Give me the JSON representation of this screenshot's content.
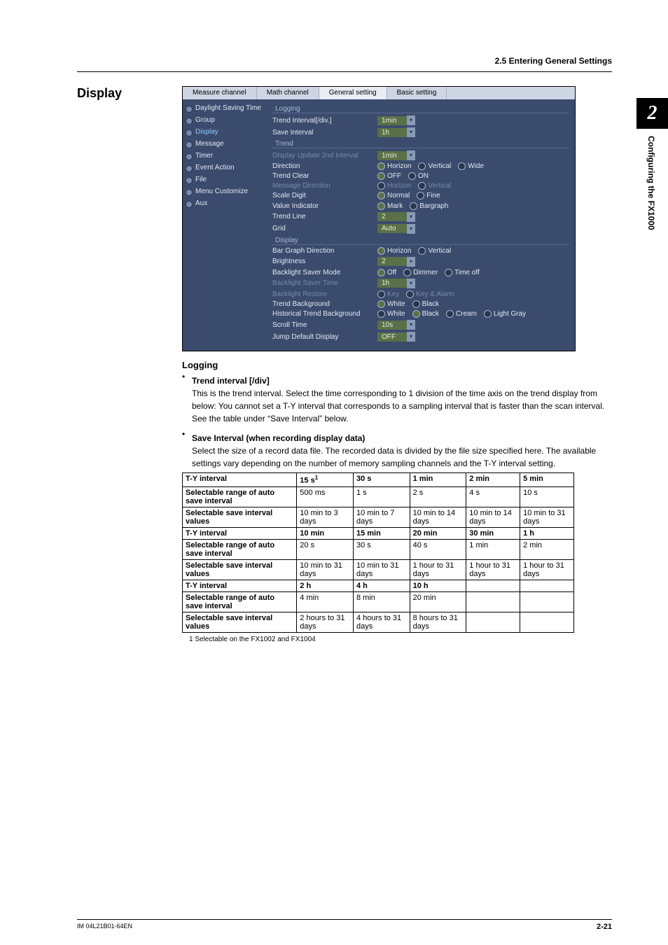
{
  "header": {
    "section": "2.5 Entering General Settings"
  },
  "sidetab": {
    "num": "2",
    "label": "Configuring the FX1000"
  },
  "heading": "Display",
  "screenshot": {
    "tabs": [
      "Measure channel",
      "Math channel",
      "General setting",
      "Basic setting"
    ],
    "active_tab": 2,
    "nav": [
      "Daylight Saving Time",
      "Group",
      "Display",
      "Message",
      "Timer",
      "Event Action",
      "File",
      "Menu Customize",
      "Aux"
    ],
    "nav_selected": "Display",
    "groups": {
      "logging": {
        "title": "Logging",
        "trend_interval_label": "Trend Interval[/div.]",
        "trend_interval_value": "1min",
        "save_interval_label": "Save Interval",
        "save_interval_value": "1h"
      },
      "trend": {
        "title": "Trend",
        "display_update_label": "Display Update 2nd Interval",
        "display_update_value": "1min",
        "direction_label": "Direction",
        "direction_opts": [
          "Horizon",
          "Vertical",
          "Wide"
        ],
        "trend_clear_label": "Trend Clear",
        "trend_clear_opts": [
          "OFF",
          "ON"
        ],
        "message_dir_label": "Message Direction",
        "message_dir_opts": [
          "Horizon",
          "Vertical"
        ],
        "scale_digit_label": "Scale Digit",
        "scale_digit_opts": [
          "Normal",
          "Fine"
        ],
        "value_indicator_label": "Value Indicator",
        "value_indicator_opts": [
          "Mark",
          "Bargraph"
        ],
        "trend_line_label": "Trend Line",
        "trend_line_value": "2",
        "grid_label": "Grid",
        "grid_value": "Auto"
      },
      "display": {
        "title": "Display",
        "bar_dir_label": "Bar Graph Direction",
        "bar_dir_opts": [
          "Horizon",
          "Vertical"
        ],
        "brightness_label": "Brightness",
        "brightness_value": "2",
        "saver_mode_label": "Backlight Saver Mode",
        "saver_mode_opts": [
          "Off",
          "Dimmer",
          "Time off"
        ],
        "saver_time_label": "Backlight Saver Time",
        "saver_time_value": "1h",
        "restore_label": "Backlight Restore",
        "restore_opts": [
          "Key",
          "Key & Alarm"
        ],
        "trend_bg_label": "Trend Background",
        "trend_bg_opts": [
          "White",
          "Black"
        ],
        "hist_bg_label": "Historical Trend Background",
        "hist_bg_opts": [
          "White",
          "Black",
          "Cream",
          "Light Gray"
        ],
        "scroll_time_label": "Scroll Time",
        "scroll_time_value": "10s",
        "jump_label": "Jump Default Display",
        "jump_value": "OFF"
      }
    }
  },
  "body": {
    "logging_h": "Logging",
    "trend_int_h": "Trend interval [/div]",
    "trend_int_p": "This is the trend interval. Select the time corresponding to 1 division of the time axis on the trend display from below: You cannot set a T-Y interval that corresponds to a sampling interval that is faster than the scan interval. See the table under “Save Interval” below.",
    "save_int_h": "Save Interval (when recording display data)",
    "save_int_p": "Select the size of a record data file.  The recorded data is divided by the file size specified here.  The available settings vary depending on the number of memory sampling channels and the T-Y interval setting."
  },
  "table": {
    "rows": [
      [
        "T-Y interval",
        "15 s¹",
        "30 s",
        "1 min",
        "2 min",
        "5 min"
      ],
      [
        "Selectable range of auto save interval",
        "500 ms",
        "1 s",
        "2 s",
        "4 s",
        "10 s"
      ],
      [
        "Selectable save interval values",
        "10 min to 3 days",
        "10 min to 7 days",
        "10 min to 14 days",
        "10 min to 14 days",
        "10 min to 31 days"
      ],
      [
        "T-Y interval",
        "10 min",
        "15 min",
        "20 min",
        "30 min",
        "1 h"
      ],
      [
        "Selectable range of auto save interval",
        "20 s",
        "30 s",
        "40 s",
        "1 min",
        "2 min"
      ],
      [
        "Selectable save interval values",
        "10 min to 31 days",
        "10 min to 31 days",
        "1 hour to 31 days",
        "1 hour to 31 days",
        "1 hour to 31 days"
      ],
      [
        "T-Y interval",
        "2 h",
        "4 h",
        "10 h",
        "",
        ""
      ],
      [
        "Selectable range of auto save interval",
        "4 min",
        "8 min",
        "20 min",
        "",
        ""
      ],
      [
        "Selectable save interval values",
        "2 hours to 31 days",
        "4 hours to 31 days",
        "8 hours to 31 days",
        "",
        ""
      ]
    ],
    "footnote": "1  Selectable on the FX1002 and FX1004"
  },
  "footer": {
    "doc": "IM 04L21B01-64EN",
    "page": "2-21"
  }
}
